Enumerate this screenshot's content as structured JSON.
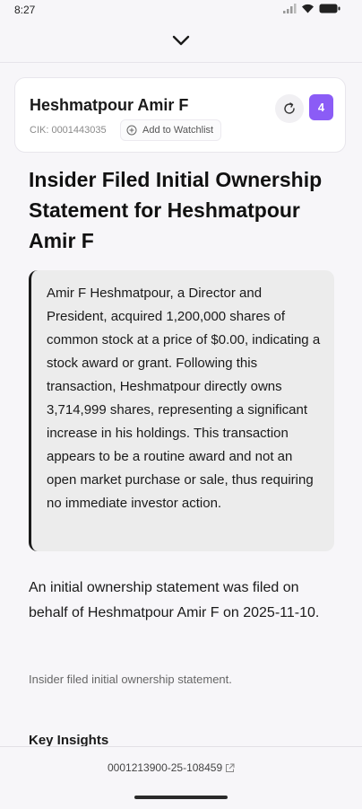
{
  "status_bar": {
    "time": "8:27"
  },
  "header": {
    "name": "Heshmatpour Amir F",
    "cik": "CIK: 0001443035",
    "watchlist_label": "Add to Watchlist",
    "badge_count": "4"
  },
  "article": {
    "title": "Insider Filed Initial Ownership Statement for Heshmatpour Amir F",
    "summary": "Amir F Heshmatpour, a Director and President, acquired 1,200,000 shares of common stock at a price of $0.00, indicating a stock award or grant. Following this transaction, Heshmatpour directly owns 3,714,999 shares, representing a significant increase in his holdings. This transaction appears to be a routine award and not an open market purchase or sale, thus requiring no immediate investor action.",
    "description": "An initial ownership statement was filed on behalf of Heshmatpour Amir F on 2025-11-10.",
    "subtext": "Insider filed initial ownership statement.",
    "section_heading": "Key Insights"
  },
  "footer": {
    "accession": "0001213900-25-108459"
  },
  "icons": [
    "chevron-down-icon",
    "refresh-icon",
    "plus-circle-icon",
    "external-link-icon",
    "signal-icon",
    "wifi-icon",
    "battery-icon"
  ],
  "colors": {
    "accent": "#8b5cf6",
    "background": "#f7f6f9",
    "summary_bg": "#ececec"
  }
}
